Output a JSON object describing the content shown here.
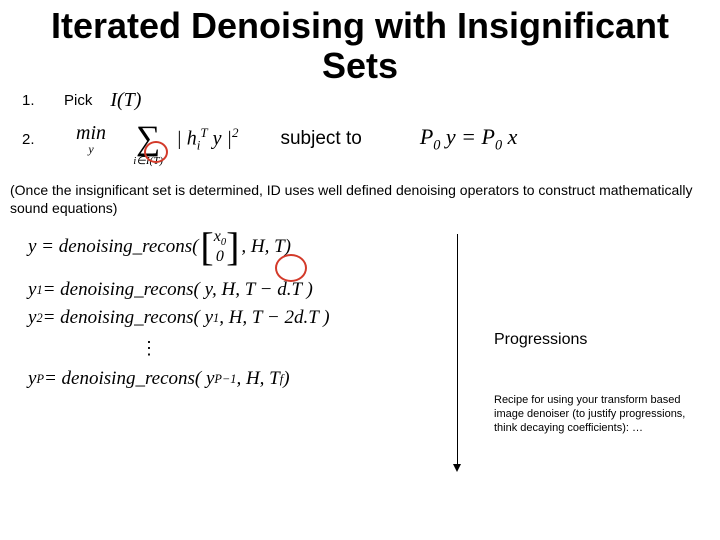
{
  "title": "Iterated Denoising with Insignificant Sets",
  "items": {
    "num1": "1.",
    "pick": "Pick",
    "IT": "I(T)",
    "num2": "2.",
    "min": "min",
    "miny": "y",
    "sumidx": "i∈I(T)",
    "sumterm_open": "| h",
    "sumterm_i": "i",
    "sumterm_T": "T",
    "sumterm_mid": " y |",
    "sumterm_sq": "2",
    "subject": "subject to",
    "constraint_l": "P",
    "constraint_0a": "0",
    "constraint_mid": " y = P",
    "constraint_0b": "0",
    "constraint_r": " x"
  },
  "para": "(Once the insignificant set is determined, ID uses well defined denoising operators to construct mathematically sound equations)",
  "eq1_lhs": "y = denoising_recons(",
  "eq1_vec_top": "x",
  "eq1_vec_top_sub": "0",
  "eq1_vec_bot": "0",
  "eq1_rhs": ", H, T)",
  "eq2": "y",
  "eq2_sup": "1",
  "eq2_body": " = denoising_recons( y, H, T − d.T )",
  "eq3": "y",
  "eq3_sup": "2",
  "eq3_body": " = denoising_recons( y",
  "eq3_arg_sup": "1",
  "eq3_tail": ", H, T − 2d.T )",
  "dots": "⋮",
  "eq4": "y",
  "eq4_sup": "P",
  "eq4_body": " = denoising_recons( y",
  "eq4_arg_sup": "P−1",
  "eq4_tail": ", H, T",
  "eq4_f": "f",
  "eq4_close": " )",
  "progressions": "Progressions",
  "recipe": "Recipe for using your transform based image denoiser (to justify progressions, think decaying coefficients): …"
}
